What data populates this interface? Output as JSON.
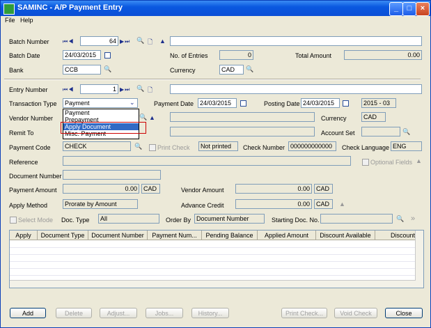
{
  "window": {
    "title": "SAMINC - A/P Payment Entry",
    "min": "_",
    "max": "□",
    "close": "×"
  },
  "menu": {
    "file": "File",
    "help": "Help"
  },
  "batch": {
    "number_label": "Batch Number",
    "number": "64",
    "date_label": "Batch Date",
    "date": "24/03/2015",
    "entries_label": "No. of Entries",
    "entries": "0",
    "total_label": "Total Amount",
    "total": "0.00",
    "bank_label": "Bank",
    "bank": "CCB",
    "currency_label": "Currency",
    "currency": "CAD"
  },
  "entry": {
    "number_label": "Entry Number",
    "number": "1",
    "trans_type_label": "Transaction Type",
    "trans_type": "Payment",
    "payment_date_label": "Payment Date",
    "payment_date": "24/03/2015",
    "posting_date_label": "Posting Date",
    "posting_date": "24/03/2015",
    "period": "2015 - 03",
    "vendor_label": "Vendor Number",
    "currency_label": "Currency",
    "currency": "CAD",
    "remit_label": "Remit To",
    "account_set_label": "Account Set",
    "payment_code_label": "Payment Code",
    "payment_code": "CHECK",
    "print_check_label": "Print Check",
    "print_status": "Not printed",
    "check_number_label": "Check Number",
    "check_number": "000000000000",
    "check_language_label": "Check Language",
    "check_language": "ENG",
    "reference_label": "Reference",
    "optional_fields_label": "Optional Fields",
    "document_number_label": "Document Number",
    "payment_amount_label": "Payment Amount",
    "payment_amount": "0.00",
    "payment_currency": "CAD",
    "vendor_amount_label": "Vendor Amount",
    "vendor_amount": "0.00",
    "vendor_currency": "CAD",
    "apply_method_label": "Apply Method",
    "apply_method": "Prorate by Amount",
    "advance_credit_label": "Advance Credit",
    "advance_credit": "0.00",
    "advance_currency": "CAD"
  },
  "dropdown": {
    "options": [
      "Payment",
      "Prepayment",
      "Apply Document",
      "Misc. Payment"
    ],
    "selected": "Apply Document"
  },
  "filter": {
    "select_mode_label": "Select Mode",
    "doc_type_label": "Doc. Type",
    "doc_type": "All",
    "order_by_label": "Order By",
    "order_by": "Document Number",
    "starting_doc_label": "Starting Doc. No."
  },
  "grid": {
    "columns": [
      "Apply",
      "Document Type",
      "Document Number",
      "Payment Num...",
      "Pending Balance",
      "Applied Amount",
      "Discount Available",
      "Discount"
    ]
  },
  "buttons": {
    "add": "Add",
    "delete": "Delete",
    "adjust": "Adjust...",
    "jobs": "Jobs...",
    "history": "History...",
    "print_check": "Print Check...",
    "void_check": "Void Check",
    "close": "Close"
  },
  "nav_glyphs": {
    "first_prev": "⏮◀",
    "next_last": "▶⏭",
    "zoom": "🔍",
    "new": "🗋",
    "up": "▲",
    "more": "»"
  }
}
